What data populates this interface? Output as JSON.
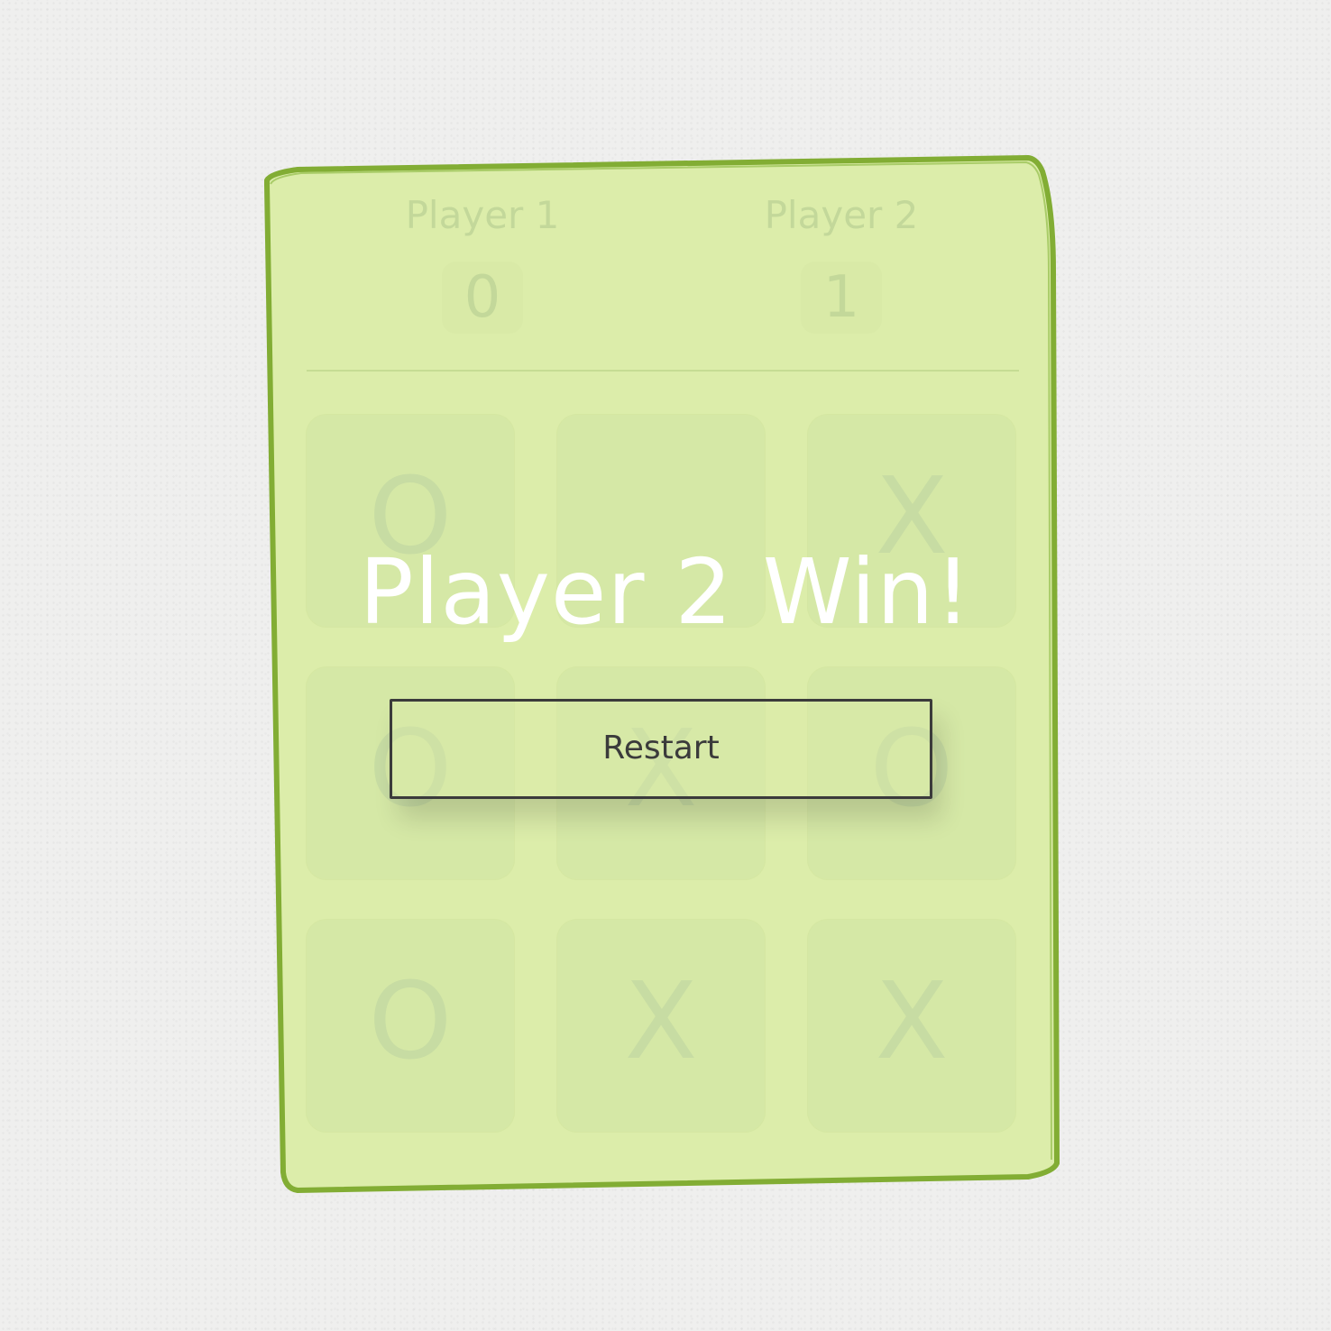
{
  "scoreboard": {
    "player1": {
      "label": "Player 1",
      "score": "0"
    },
    "player2": {
      "label": "Player 2",
      "score": "1"
    }
  },
  "board": {
    "cells": [
      "O",
      "",
      "X",
      "O",
      "X",
      "O",
      "O",
      "X",
      "X"
    ]
  },
  "result": {
    "message": "Player 2 Win!",
    "restart_label": "Restart"
  },
  "colors": {
    "background": "#efefee",
    "card_fill": "#dcedaa",
    "card_border": "#82ad34",
    "overlay_text": "#ffffff",
    "button_border": "#3b3b3b"
  }
}
